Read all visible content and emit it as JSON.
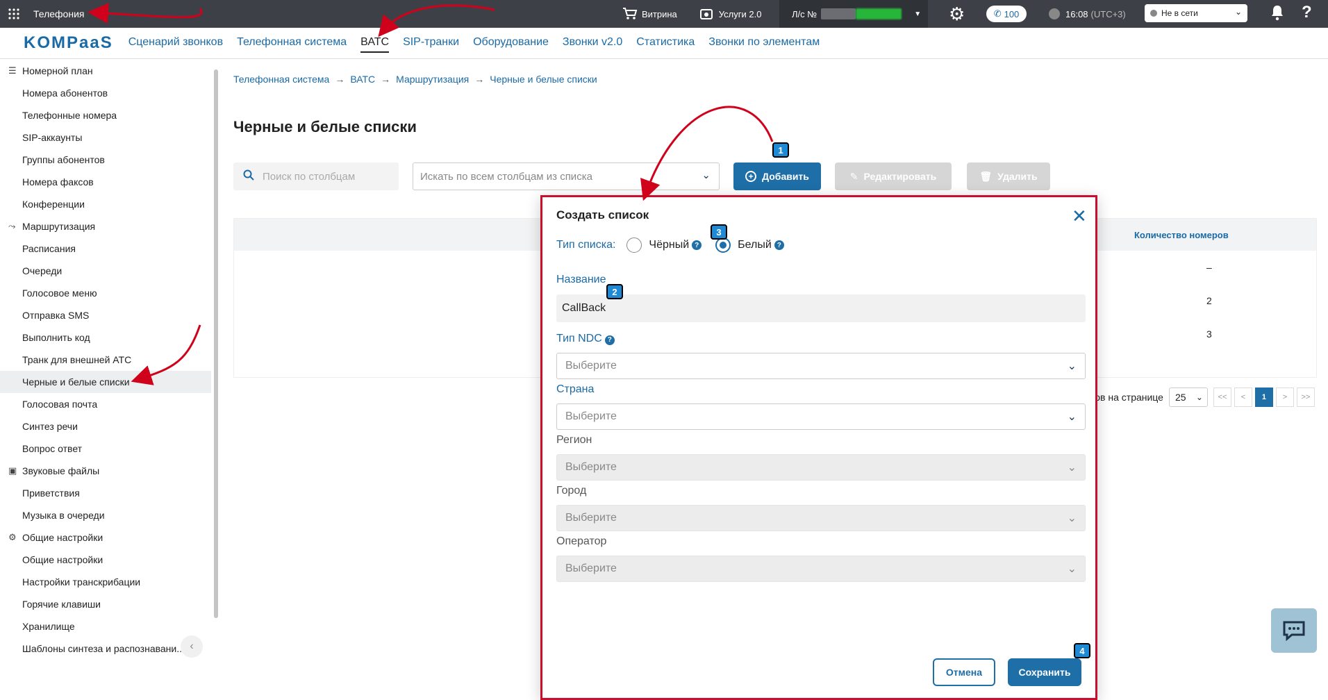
{
  "topbar": {
    "app_title": "Телефония",
    "vitrina": "Витрина",
    "services": "Услуги 2.0",
    "account_label": "Л/с №",
    "calls_count": "100",
    "time": "16:08",
    "tz": "(UTC+3)",
    "status": "Не в сети"
  },
  "nav": {
    "logo": "KOMPaaS",
    "tabs": [
      "Сценарий звонков",
      "Телефонная система",
      "ВАТС",
      "SIP-транки",
      "Оборудование",
      "Звонки v2.0",
      "Статистика",
      "Звонки по элементам"
    ],
    "active": "ВАТС"
  },
  "sidebar": {
    "items": [
      {
        "label": "Номерной план",
        "head": true,
        "icon": "list-icon"
      },
      {
        "label": "Номера абонентов"
      },
      {
        "label": "Телефонные номера"
      },
      {
        "label": "SIP-аккаунты"
      },
      {
        "label": "Группы абонентов"
      },
      {
        "label": "Номера факсов"
      },
      {
        "label": "Конференции"
      },
      {
        "label": "Маршрутизация",
        "head": true,
        "icon": "routing-icon"
      },
      {
        "label": "Расписания"
      },
      {
        "label": "Очереди"
      },
      {
        "label": "Голосовое меню"
      },
      {
        "label": "Отправка SMS"
      },
      {
        "label": "Выполнить код"
      },
      {
        "label": "Транк для внешней АТС"
      },
      {
        "label": "Черные и белые списки",
        "active": true
      },
      {
        "label": "Голосовая почта"
      },
      {
        "label": "Синтез речи"
      },
      {
        "label": "Вопрос ответ"
      },
      {
        "label": "Звуковые файлы",
        "head": true,
        "icon": "audio-files-icon"
      },
      {
        "label": "Приветствия"
      },
      {
        "label": "Музыка в очереди"
      },
      {
        "label": "Общие настройки",
        "head": true,
        "icon": "gear-icon"
      },
      {
        "label": "Общие настройки"
      },
      {
        "label": "Настройки транскрибации"
      },
      {
        "label": "Горячие клавиши"
      },
      {
        "label": "Хранилище"
      },
      {
        "label": "Шаблоны синтеза и распознавани..."
      }
    ]
  },
  "main": {
    "breadcrumb": [
      "Телефонная система",
      "ВАТС",
      "Маршрутизация",
      "Черные и белые списки"
    ],
    "title": "Черные и белые списки",
    "search_placeholder": "Поиск по столбцам",
    "column_select": "Искать по всем столбцам из списка",
    "add_btn": "Добавить",
    "edit_btn": "Редактировать",
    "delete_btn": "Удалить",
    "col_count_header": "Количество номеров",
    "counts": [
      "–",
      "2",
      "3"
    ],
    "rows_per_page_label": "тов на странице",
    "rows_per_page": "25",
    "page": "1",
    "pager": [
      "<<",
      "<",
      ">",
      ">>"
    ]
  },
  "modal": {
    "title": "Создать список",
    "list_type_label": "Тип списка:",
    "black": "Чёрный",
    "white": "Белый",
    "name_label": "Название",
    "name_value": "CallBack",
    "ndc_label": "Тип NDC",
    "country_label": "Страна",
    "region_label": "Регион",
    "city_label": "Город",
    "operator_label": "Оператор",
    "placeholder": "Выберите",
    "cancel": "Отмена",
    "save": "Сохранить"
  },
  "annotations": {
    "badges": [
      "1",
      "2",
      "3",
      "4"
    ]
  }
}
